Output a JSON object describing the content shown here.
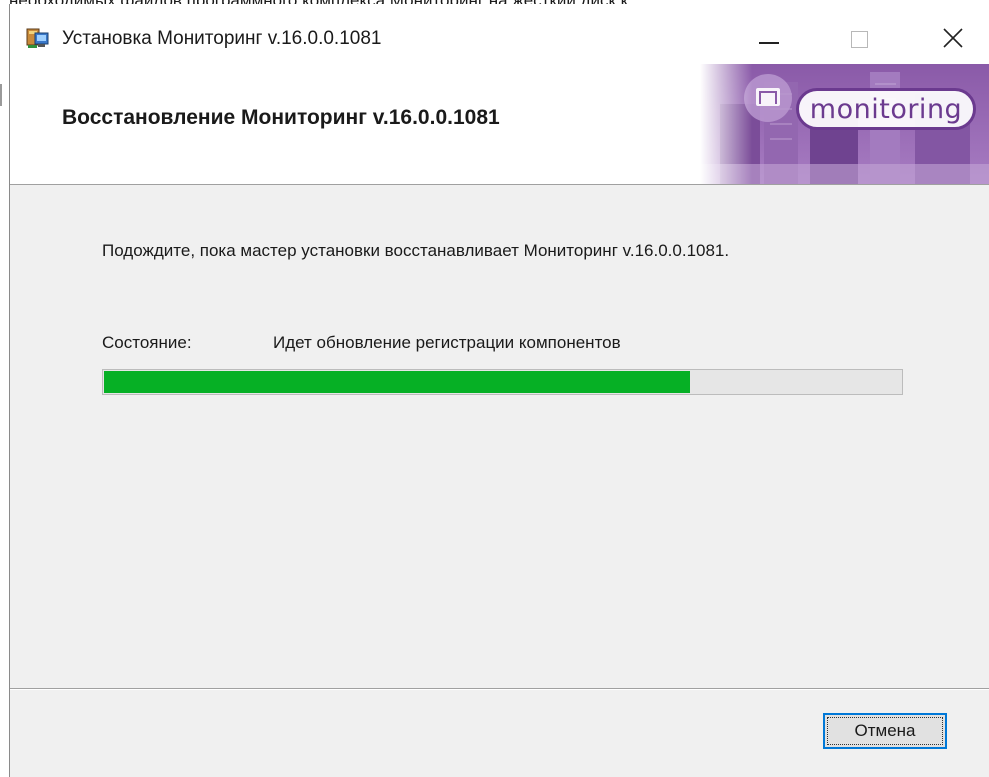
{
  "background_doc": {
    "text": "необходимых файлов программного комплекса Мониторинг на жесткий диск к"
  },
  "window": {
    "title": "Установка Мониторинг v.16.0.0.1081",
    "controls": {
      "minimize": "minimize-icon",
      "maximize": "maximize-icon",
      "close": "close-icon"
    }
  },
  "header": {
    "title": "Восстановление Мониторинг v.16.0.0.1081",
    "logo_text": "monitoring",
    "logo_color": "#6b3a8f"
  },
  "content": {
    "wait_message": "Подождите, пока мастер установки восстанавливает Мониторинг v.16.0.0.1081.",
    "status_label": "Состояние:",
    "status_value": "Идет обновление регистрации компонентов",
    "progress_fraction": 0.735,
    "progress_color": "#06b025"
  },
  "footer": {
    "cancel_label": "Отмена"
  }
}
